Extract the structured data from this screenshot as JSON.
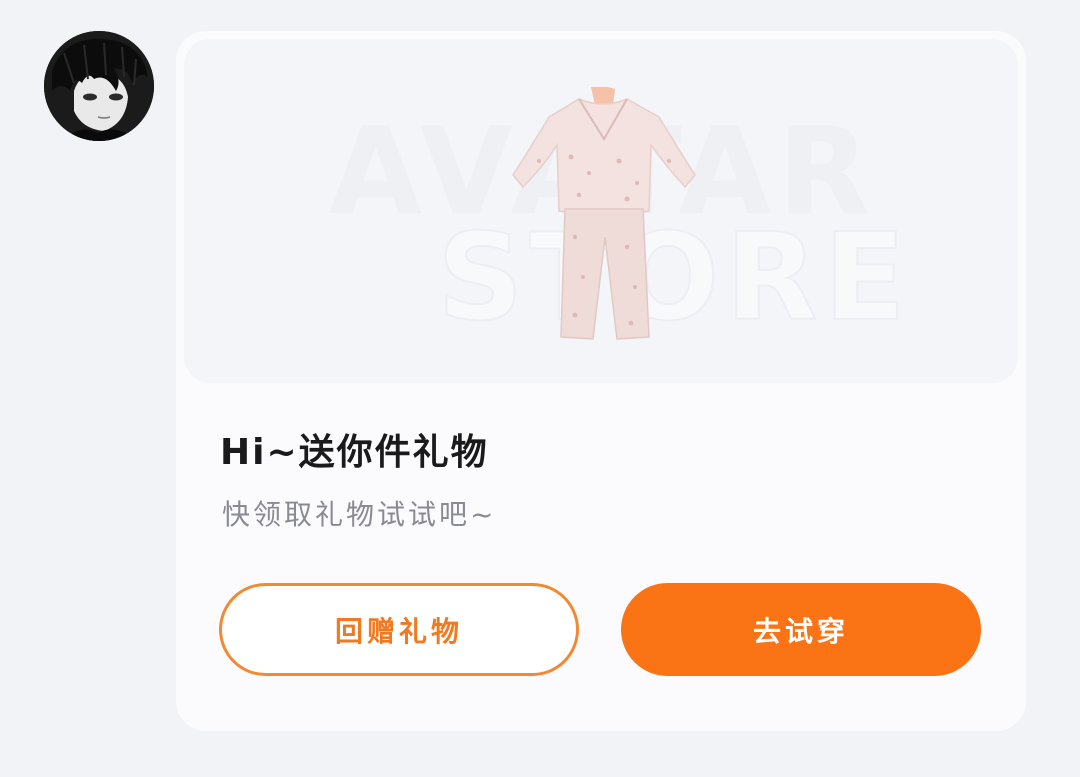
{
  "sender": {
    "avatar_icon": "user-avatar"
  },
  "card": {
    "preview": {
      "watermark_line1": "AVATAR",
      "watermark_line2": "STORE",
      "item_icon": "pajama-outfit"
    },
    "title": "Hi~送你件礼物",
    "subtitle": "快领取礼物试试吧~",
    "buttons": {
      "return_gift": "回赠礼物",
      "try_on": "去试穿"
    }
  },
  "colors": {
    "accent": "#fa7314",
    "outline": "#f28a33",
    "background": "#f2f3f7"
  }
}
